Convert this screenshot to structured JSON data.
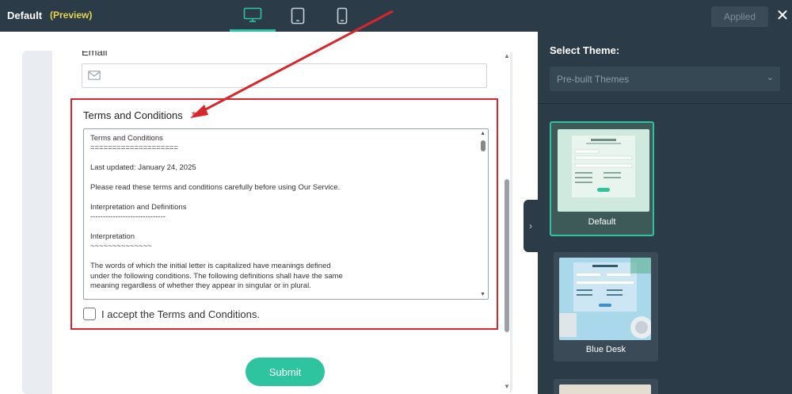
{
  "header": {
    "title": "Default",
    "preview_badge": "(Preview)",
    "applied_label": "Applied",
    "close_icon": "close-icon",
    "device_icons": [
      "desktop-icon",
      "tablet-icon",
      "mobile-icon"
    ]
  },
  "form": {
    "email_label": "Email",
    "terms_title": "Terms and Conditions",
    "required_mark": "*",
    "terms_text": "Terms and Conditions\n====================\n\nLast updated: January 24, 2025\n\nPlease read these terms and conditions carefully before using Our Service.\n\nInterpretation and Definitions\n------------------------------\n\nInterpretation\n~~~~~~~~~~~~~~\n\nThe words of which the initial letter is capitalized have meanings defined\nunder the following conditions. The following definitions shall have the same\nmeaning regardless of whether they appear in singular or in plural.",
    "accept_label": "I accept the Terms and Conditions.",
    "submit_label": "Submit"
  },
  "theme_panel": {
    "heading": "Select Theme:",
    "select_value": "Pre-built Themes",
    "themes": [
      {
        "name": "Default",
        "selected": true
      },
      {
        "name": "Blue Desk",
        "selected": false
      }
    ]
  },
  "colors": {
    "accent": "#2ec4a0",
    "highlight_red": "#d7262c",
    "panel_bg": "#2b3b47",
    "preview_badge": "#e8d44d"
  }
}
